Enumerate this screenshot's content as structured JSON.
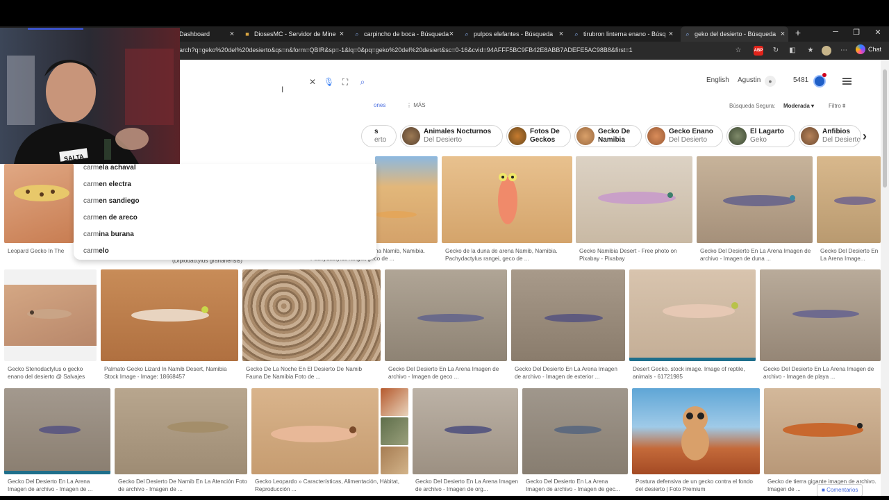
{
  "browser": {
    "tabs": [
      {
        "title": "Dashboard",
        "favicon": "dashboard-icon"
      },
      {
        "title": "DiosesMC - Servidor de Minecraft",
        "favicon": "minecraft-icon"
      },
      {
        "title": "carpincho de boca - Búsqueda",
        "favicon": "search-icon"
      },
      {
        "title": "pulpos elefantes - Búsqueda",
        "favicon": "search-icon"
      },
      {
        "title": "tirubron linterna enano - Búsqueda",
        "favicon": "search-icon"
      },
      {
        "title": "geko del desierto - Búsqueda Imágenes",
        "favicon": "search-icon"
      }
    ],
    "url": "arch?q=geko%20del%20desierto&qs=n&form=QBIR&sp=-1&lq=0&pq=geko%20del%20desiert&sc=0-16&cvid=94AFFF5BC9FB42E8ABB7ADEFE5AC98B8&first=1",
    "copilot_label": "Chat",
    "abp_label": "ABP"
  },
  "header": {
    "language": "English",
    "user": "Agustin",
    "points": "5481",
    "safe_search_label": "Búsqueda Segura:",
    "safe_search_value": "Moderada",
    "filter_label": "Filtro",
    "scope_partial": "ones",
    "more_label": "MÁS"
  },
  "chips": [
    {
      "strong": "s",
      "light": "erto"
    },
    {
      "strong": "Animales Nocturnos",
      "light": "Del Desierto"
    },
    {
      "strong": "Fotos De",
      "light": "Geckos"
    },
    {
      "strong": "Gecko De",
      "light": "Namibia"
    },
    {
      "strong": "Gecko Enano",
      "light": "Del Desierto"
    },
    {
      "strong": "El Lagarto",
      "light": "Geko"
    },
    {
      "strong": "Anfibios",
      "light": "Del Desierto"
    }
  ],
  "suggestions": [
    {
      "prefix": "carm",
      "suffix": "ela achaval"
    },
    {
      "prefix": "carm",
      "suffix": "en electra"
    },
    {
      "prefix": "carm",
      "suffix": "en sandiego"
    },
    {
      "prefix": "carm",
      "suffix": "en de areco"
    },
    {
      "prefix": "carm",
      "suffix": "ina burana"
    },
    {
      "prefix": "carm",
      "suffix": "elo"
    }
  ],
  "row1_captions": [
    "Leopard Gecko In The De...",
    "(Dipiodactylus granariensis)",
    "Pachydactylus rangei, geco de ...",
    "na Namib, Namibia.",
    "Gecko de la duna de arena Namib, Namibia. Pachydactylus rangei, geco de ...",
    "Gecko Namibia Desert - Free photo on Pixabay - Pixabay",
    "Gecko Del Desierto En La Arena Imagen de archivo - Imagen de duna ...",
    "Gecko Del Desierto En La Arena Image..."
  ],
  "row2_captions": [
    "Gecko Stenodactylus o gecko enano del desierto @ Salvajes",
    "Palmato Gecko Lizard In Namib Desert, Namibia Stock Image - Image: 18668457",
    "Gecko De La Noche En El Desierto De Namib Fauna De Namibia Foto de ...",
    "Gecko Del Desierto En La Arena Imagen de archivo - Imagen de geco ...",
    "Gecko Del Desierto En La Arena Imagen de archivo - Imagen de exterior ...",
    "Desert Gecko. stock image. Image of reptile, animals - 61721985",
    "Gecko Del Desierto En La Arena Imagen de archivo - Imagen de playa ..."
  ],
  "row3_captions": [
    "Gecko Del Desierto En La Arena Imagen de archivo - Imagen de ...",
    "Gecko Del Desierto De Namib En La Atención Foto de archivo - Imagen de ...",
    "Gecko Leopardo » Características, Alimentación, Hábitat, Reproducción ...",
    "Gecko Del Desierto En La Arena Imagen de archivo - Imagen de org...",
    "Gecko Del Desierto En La Arena Imagen de archivo - Imagen de gec...",
    "Postura defensiva de un gecko contra el fondo del desierto | Foto Premium",
    "Gecko de tierra gigante imagen de archivo. Imagen de ..."
  ],
  "webcam_sign": "SALTA",
  "feedback_label": "Comentarios",
  "colors": {
    "accent": "#4a6ee0",
    "sand": "#c98d5a",
    "tab_bg": "#1f1f1f"
  }
}
